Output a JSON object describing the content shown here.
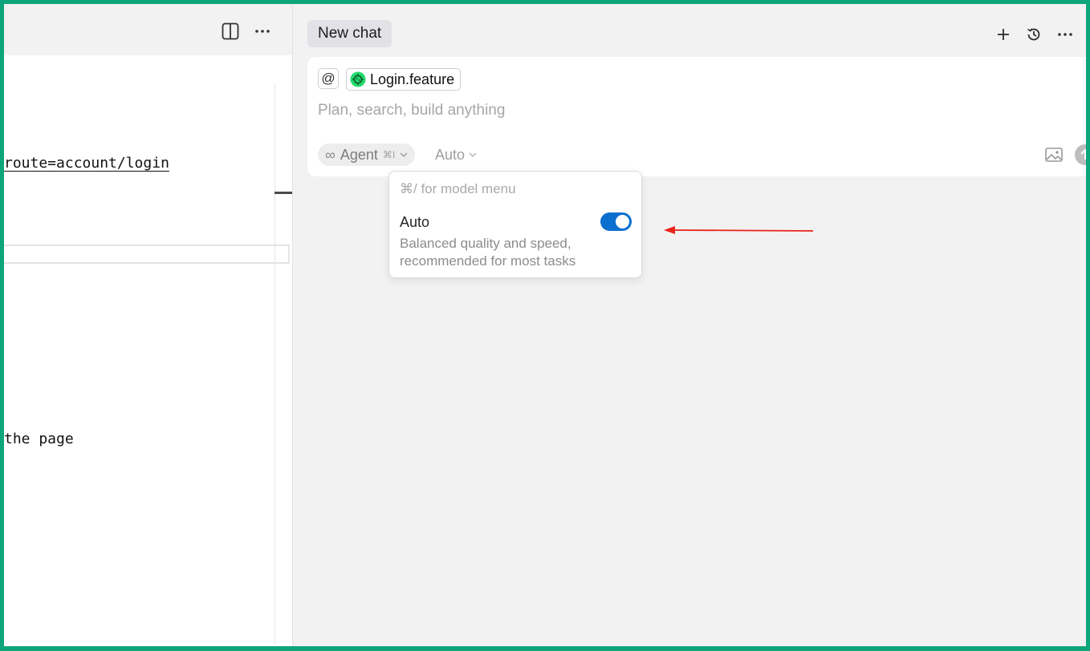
{
  "editor": {
    "code_lines": [
      "route=account/login",
      "the page"
    ]
  },
  "chat": {
    "tab_title": "New chat",
    "composer": {
      "at_symbol": "@",
      "file_chip": "Login.feature",
      "placeholder": "Plan, search, build anything",
      "mode": {
        "label": "Agent",
        "infinity": "∞",
        "shortcut": "⌘I"
      },
      "model_select_value": "Auto"
    },
    "model_menu": {
      "hint": "⌘/ for model menu",
      "auto_label": "Auto",
      "auto_description": "Balanced quality and speed, recommended for most tasks",
      "auto_enabled": true
    }
  },
  "colors": {
    "frame_border": "#0fa57a",
    "toggle_on": "#0a6fcf",
    "annotation_arrow": "#e8231a"
  },
  "icons": [
    "split-view-icon",
    "more-icon",
    "plus-icon",
    "history-icon",
    "at-icon",
    "cucumber-icon",
    "infinity-icon",
    "chevron-down-icon",
    "image-icon",
    "send-icon"
  ]
}
